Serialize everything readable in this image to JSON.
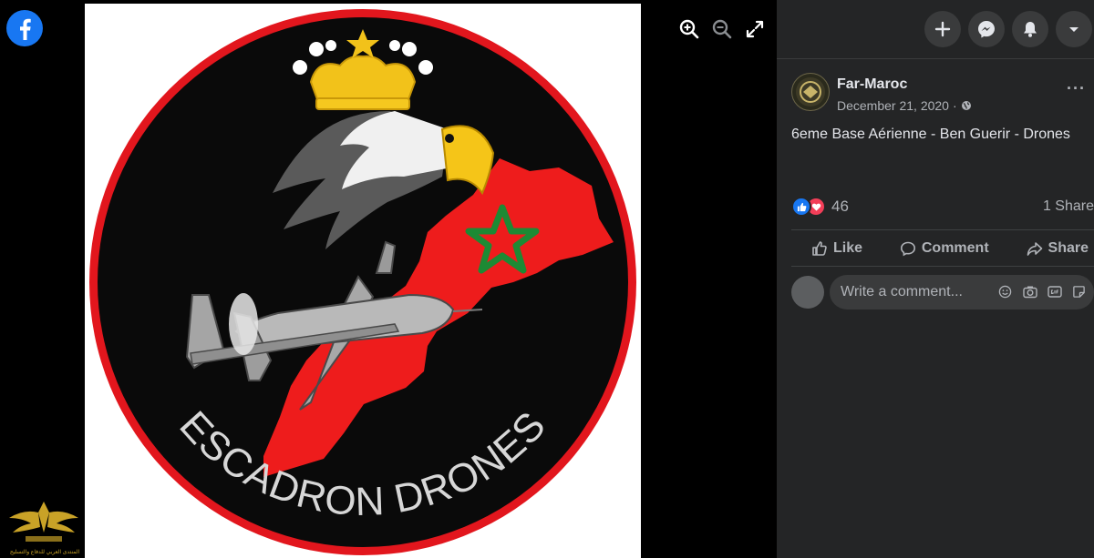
{
  "brand": {
    "logo_icon": "facebook-logo-icon",
    "color": "#1877f2"
  },
  "viewer": {
    "zoom_in_icon": "zoom-in-icon",
    "zoom_out_icon": "zoom-out-icon",
    "fullscreen_icon": "fullscreen-icon"
  },
  "photo": {
    "patch_text": "ESCADRON DRONES",
    "colors": {
      "ring": "#e2161d",
      "disc": "#0a0a0a",
      "map": "#ee1c1c",
      "star": "#1d8a34",
      "crown": "#f2c21a"
    }
  },
  "topbar": {
    "buttons": [
      {
        "icon": "plus-icon"
      },
      {
        "icon": "messenger-icon"
      },
      {
        "icon": "bell-icon"
      },
      {
        "icon": "caret-down-icon"
      }
    ]
  },
  "post": {
    "author": "Far-Maroc",
    "date": "December 21, 2020",
    "separator": "·",
    "privacy_icon": "globe-icon",
    "more_label": "···",
    "text": "6eme Base Aérienne - Ben Guerir - Drones",
    "reactions": {
      "count": "46",
      "icons": [
        "like-icon",
        "love-icon"
      ]
    },
    "shares": "1 Share"
  },
  "actions": {
    "like": "Like",
    "comment": "Comment",
    "share": "Share"
  },
  "comment_box": {
    "placeholder": "Write a comment..."
  },
  "watermark": {
    "text": "المنتدى العربي للدفاع والتسليح"
  }
}
